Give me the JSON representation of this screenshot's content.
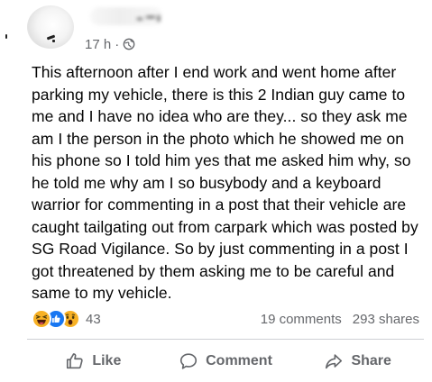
{
  "post": {
    "timestamp": "17 h",
    "separator": "·",
    "audience_icon": "globe-icon",
    "body": "This afternoon after I end work and went home after parking my vehicle, there is this 2 Indian guy came to me and I have no idea who are they... so they ask me am I the person in the photo which he showed me on his phone so I told him yes that me asked him why, so he told me why am I so busybody and a keyboard warrior for commenting in a post that their vehicle are caught tailgating out from carpark which was posted by SG Road Vigilance. So by just commenting in a post I got threatened by them asking me to be careful and same to my vehicle."
  },
  "reactions": {
    "icons": [
      "haha-icon",
      "like-icon",
      "wow-icon"
    ],
    "count": "43",
    "comments": "19 comments",
    "shares": "293 shares"
  },
  "actions": {
    "like_label": "Like",
    "comment_label": "Comment",
    "share_label": "Share"
  },
  "colors": {
    "text": "#050505",
    "secondary": "#65676b",
    "like_blue": "#1877f2",
    "reaction_yellow": "#f7b125",
    "divider": "#ced0d4"
  }
}
